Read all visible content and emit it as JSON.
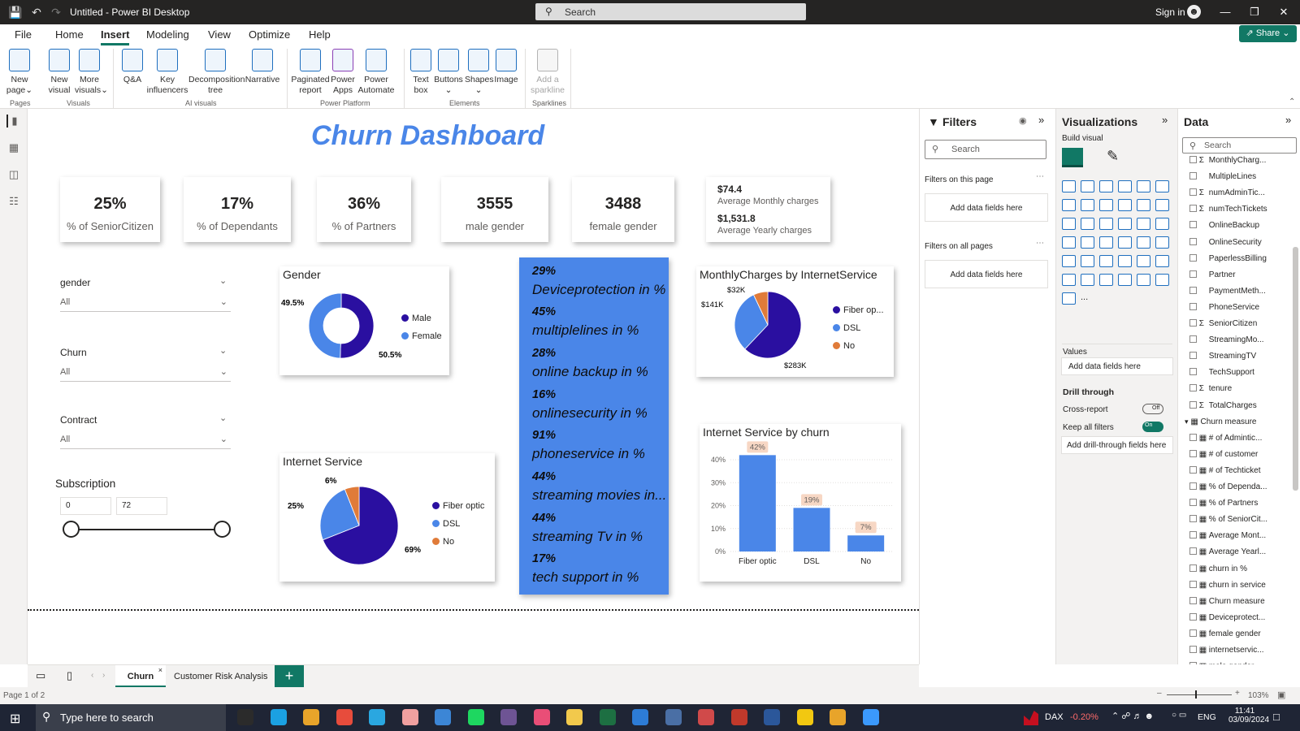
{
  "window": {
    "title": "Untitled - Power BI Desktop",
    "search_placeholder": "Search",
    "sign_in": "Sign in"
  },
  "menu": {
    "items": [
      "File",
      "Home",
      "Insert",
      "Modeling",
      "View",
      "Optimize",
      "Help"
    ],
    "active": "Insert",
    "share": "Share"
  },
  "ribbon": {
    "buttons": [
      {
        "label": "New page",
        "line2": "page"
      },
      {
        "label": "New visual"
      },
      {
        "label": "More visuals"
      },
      {
        "label": "Q&A"
      },
      {
        "label": "Key influencers"
      },
      {
        "label": "Decomposition tree"
      },
      {
        "label": "Narrative"
      },
      {
        "label": "Paginated report"
      },
      {
        "label": "Power Apps"
      },
      {
        "label": "Power Automate"
      },
      {
        "label": "Text box"
      },
      {
        "label": "Buttons"
      },
      {
        "label": "Shapes"
      },
      {
        "label": "Image"
      },
      {
        "label": "Add a sparkline"
      }
    ],
    "groups": [
      "Pages",
      "Visuals",
      "AI visuals",
      "Power Platform",
      "Elements",
      "Sparklines"
    ],
    "btn_text": {
      "new_page": "New",
      "new_page2": "page",
      "new_visual": "New",
      "new_visual2": "visual",
      "more_visuals": "More",
      "more_visuals2": "visuals",
      "qa": "Q&A",
      "key_inf": "Key",
      "key_inf2": "influencers",
      "decomp": "Decomposition",
      "decomp2": "tree",
      "narrative": "Narrative",
      "paginated": "Paginated",
      "paginated2": "report",
      "power_apps": "Power",
      "power_apps2": "Apps",
      "power_automate": "Power",
      "power_automate2": "Automate",
      "text_box": "Text",
      "text_box2": "box",
      "buttons": "Buttons",
      "shapes": "Shapes",
      "image": "Image",
      "sparkline": "Add a",
      "sparkline2": "sparkline"
    }
  },
  "report": {
    "title": "Churn Dashboard",
    "kpis": [
      {
        "value": "25%",
        "label": "% of SeniorCitizen"
      },
      {
        "value": "17%",
        "label": "% of Dependants"
      },
      {
        "value": "36%",
        "label": "% of Partners"
      },
      {
        "value": "3555",
        "label": "male gender"
      },
      {
        "value": "3488",
        "label": "female gender"
      }
    ],
    "charges_card": {
      "v1": "$74.4",
      "l1": "Average Monthly charges",
      "v2": "$1,531.8",
      "l2": "Average Yearly charges"
    },
    "slicers": {
      "gender": {
        "label": "gender",
        "value": "All"
      },
      "churn": {
        "label": "Churn",
        "value": "All"
      },
      "contract": {
        "label": "Contract",
        "value": "All"
      },
      "subscription": {
        "label": "Subscription",
        "min": "0",
        "max": "72"
      }
    },
    "blue_card": [
      {
        "value": "29%",
        "label": "Deviceprotection in %"
      },
      {
        "value": "45%",
        "label": "multiplelines in %"
      },
      {
        "value": "28%",
        "label": "online backup in %"
      },
      {
        "value": "16%",
        "label": "onlinesecurity in %"
      },
      {
        "value": "91%",
        "label": "phoneservice in %"
      },
      {
        "value": "44%",
        "label": "streaming movies in..."
      },
      {
        "value": "44%",
        "label": "streaming Tv in %"
      },
      {
        "value": "17%",
        "label": "tech support in %"
      }
    ]
  },
  "chart_data": [
    {
      "type": "pie",
      "title": "Gender",
      "donut": true,
      "categories": [
        "Male",
        "Female"
      ],
      "values": [
        50.5,
        49.5
      ],
      "data_labels": [
        "50.5%",
        "49.5%"
      ],
      "colors": [
        "#2a0fa0",
        "#4a86e8"
      ],
      "legend": "right"
    },
    {
      "type": "pie",
      "title": "Internet Service",
      "categories": [
        "Fiber optic",
        "DSL",
        "No"
      ],
      "values": [
        69,
        25,
        6
      ],
      "data_labels": [
        "69%",
        "25%",
        "6%"
      ],
      "colors": [
        "#2a0fa0",
        "#4a86e8",
        "#e07b39"
      ],
      "legend": "right"
    },
    {
      "type": "pie",
      "title": "MonthlyCharges by InternetService",
      "categories": [
        "Fiber op...",
        "DSL",
        "No"
      ],
      "values": [
        283,
        141,
        32
      ],
      "data_labels": [
        "$283K",
        "$141K",
        "$32K"
      ],
      "colors": [
        "#2a0fa0",
        "#4a86e8",
        "#e07b39"
      ],
      "legend": "right"
    },
    {
      "type": "bar",
      "title": "Internet Service by churn",
      "categories": [
        "Fiber optic",
        "DSL",
        "No"
      ],
      "values": [
        42,
        19,
        7
      ],
      "data_labels": [
        "42%",
        "19%",
        "7%"
      ],
      "ylim": [
        0,
        40
      ],
      "yticks": [
        "0%",
        "10%",
        "20%",
        "30%",
        "40%"
      ],
      "color": "#4a86e8",
      "grid": true
    }
  ],
  "filters": {
    "title": "Filters",
    "search": "Search",
    "on_page": "Filters on this page",
    "on_all": "Filters on all pages",
    "add_fields": "Add data fields here"
  },
  "visualizations": {
    "title": "Visualizations",
    "build": "Build visual",
    "values": "Values",
    "add_fields": "Add data fields here",
    "drill": "Drill through",
    "cross_report": "Cross-report",
    "cross_state": "Off",
    "keep_filters": "Keep all filters",
    "keep_state": "On",
    "add_drill": "Add drill-through fields here",
    "more": "..."
  },
  "data": {
    "title": "Data",
    "search": "Search",
    "fields": [
      {
        "name": "MonthlyCharg...",
        "sigma": true
      },
      {
        "name": "MultipleLines",
        "sigma": false
      },
      {
        "name": "numAdminTic...",
        "sigma": true
      },
      {
        "name": "numTechTickets",
        "sigma": true
      },
      {
        "name": "OnlineBackup",
        "sigma": false
      },
      {
        "name": "OnlineSecurity",
        "sigma": false
      },
      {
        "name": "PaperlessBilling",
        "sigma": false
      },
      {
        "name": "Partner",
        "sigma": false
      },
      {
        "name": "PaymentMeth...",
        "sigma": false
      },
      {
        "name": "PhoneService",
        "sigma": false
      },
      {
        "name": "SeniorCitizen",
        "sigma": true
      },
      {
        "name": "StreamingMo...",
        "sigma": false
      },
      {
        "name": "StreamingTV",
        "sigma": false
      },
      {
        "name": "TechSupport",
        "sigma": false
      },
      {
        "name": "tenure",
        "sigma": true
      },
      {
        "name": "TotalCharges",
        "sigma": true
      }
    ],
    "table": "Churn measure",
    "measures": [
      "# of Admintic...",
      "# of customer",
      "# of Techticket",
      "% of Dependa...",
      "% of Partners",
      "% of SeniorCit...",
      "Average Mont...",
      "Average Yearl...",
      "churn in %",
      "churn in service",
      "Churn measure",
      "Deviceprotect...",
      "female gender",
      "internetservic...",
      "male gender"
    ]
  },
  "pages": {
    "tabs": [
      "Churn",
      "Customer Risk Analysis"
    ],
    "active": "Churn",
    "status": "Page 1 of 2",
    "zoom": "103%",
    "add": "+"
  },
  "taskbar": {
    "search": "Type here to search",
    "dax": "DAX",
    "dax_change": "-0.20%",
    "lang": "ENG",
    "time": "11:41",
    "date": "03/09/2024"
  }
}
